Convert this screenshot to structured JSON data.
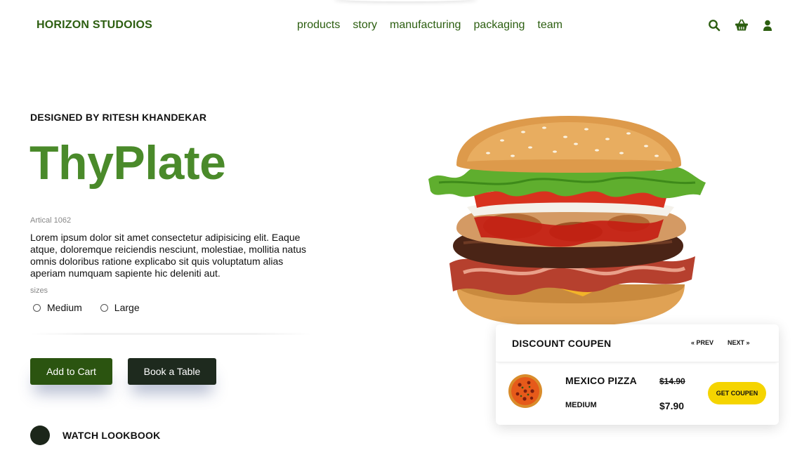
{
  "header": {
    "brand": "HORIZON STUDOIOS",
    "nav": [
      "products",
      "story",
      "manufacturing",
      "packaging",
      "team"
    ],
    "icons": [
      "search-icon",
      "basket-icon",
      "user-icon"
    ]
  },
  "hero": {
    "designed_by": "DESIGNED BY RITESH KHANDEKAR",
    "title": "ThyPlate",
    "article": "Artical 1062",
    "description": "Lorem ipsum dolor sit amet consectetur adipisicing elit. Eaque atque, doloremque reiciendis nesciunt, molestiae, mollitia natus omnis doloribus ratione explicabo sit quis voluptatum alias aperiam numquam sapiente hic deleniti aut.",
    "sizes_label": "sizes",
    "sizes": [
      "Medium",
      "Large"
    ],
    "add_to_cart": "Add to Cart",
    "book_table": "Book a Table",
    "watch": "WATCH LOOKBOOK"
  },
  "coupon": {
    "title": "DISCOUNT COUPEN",
    "prev": "« PREV",
    "next": "NEXT »",
    "item_name": "MEXICO PIZZA",
    "item_size": "MEDIUM",
    "old_price": "$14.90",
    "new_price": "$7.90",
    "button": "GET COUPEN"
  },
  "colors": {
    "brand_green": "#2c5e10",
    "hero_green": "#4a8a2a",
    "dark_button": "#1e2a1e",
    "coupon_yellow": "#f5d400"
  }
}
